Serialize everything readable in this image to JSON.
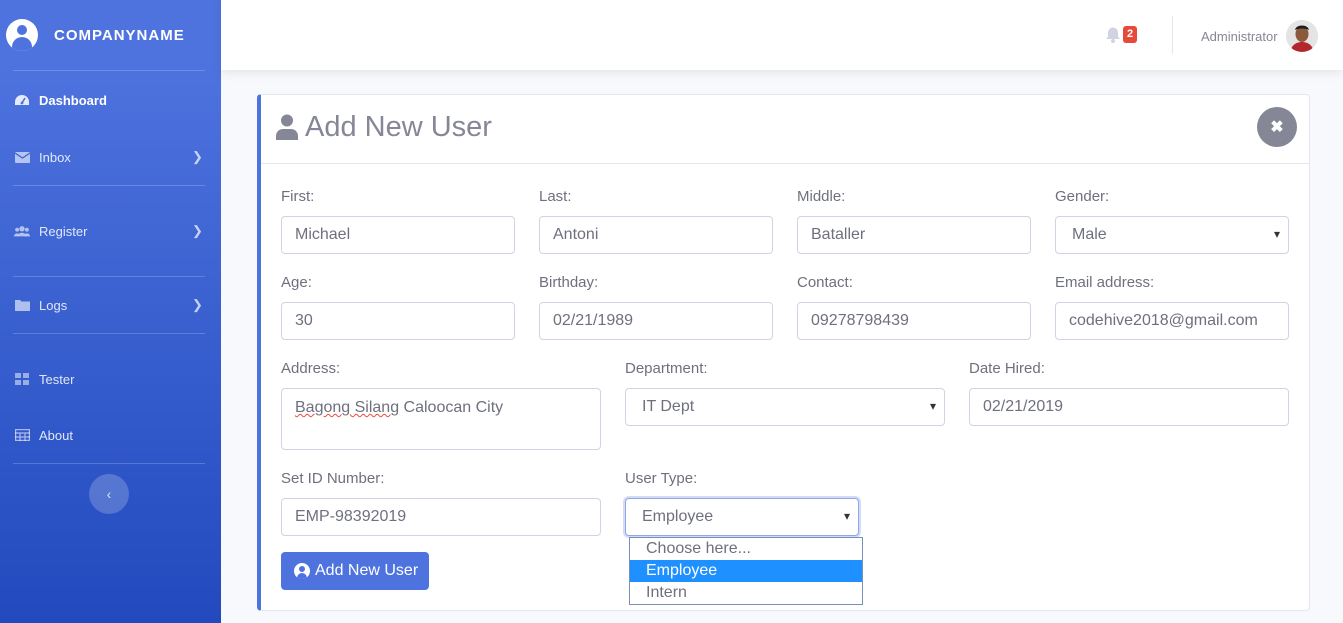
{
  "brand": {
    "name": "COMPANYNAME",
    "icon": "user-circle-icon"
  },
  "sidebar": {
    "items": [
      {
        "label": "Dashboard",
        "icon": "tachometer-icon",
        "active": true
      },
      {
        "label": "Inbox",
        "icon": "envelope-icon"
      },
      {
        "label": "Register",
        "icon": "users-icon"
      },
      {
        "label": "Logs",
        "icon": "folder-icon"
      },
      {
        "label": "Tester",
        "icon": "grid-icon"
      },
      {
        "label": "About",
        "icon": "table-icon"
      }
    ],
    "toggle_label": "‹"
  },
  "topbar": {
    "notification_count": "2",
    "user_name": "Administrator"
  },
  "form": {
    "title": "Add New User",
    "first": {
      "label": "First:",
      "value": "Michael"
    },
    "last": {
      "label": "Last:",
      "value": "Antoni"
    },
    "middle": {
      "label": "Middle:",
      "value": "Bataller"
    },
    "gender": {
      "label": "Gender:",
      "value": "Male"
    },
    "age": {
      "label": "Age:",
      "value": "30"
    },
    "birthday": {
      "label": "Birthday:",
      "value": "02/21/1989"
    },
    "contact": {
      "label": "Contact:",
      "value": "09278798439"
    },
    "email": {
      "label": "Email address:",
      "value": "codehive2018@gmail.com"
    },
    "address": {
      "label": "Address:",
      "value_underlined": "Bagong Silang",
      "value_rest": " Caloocan City"
    },
    "department": {
      "label": "Department:",
      "value": "IT Dept"
    },
    "date_hired": {
      "label": "Date Hired:",
      "value": "02/21/2019"
    },
    "id_number": {
      "label": "Set ID Number:",
      "value": "EMP-98392019"
    },
    "user_type": {
      "label": "User Type:",
      "value": "Employee",
      "options": [
        "Choose here...",
        "Employee",
        "Intern"
      ]
    },
    "submit_label": "Add New User"
  },
  "colors": {
    "primary": "#4e73df",
    "danger": "#e74a3b",
    "highlight": "#1e90ff"
  }
}
